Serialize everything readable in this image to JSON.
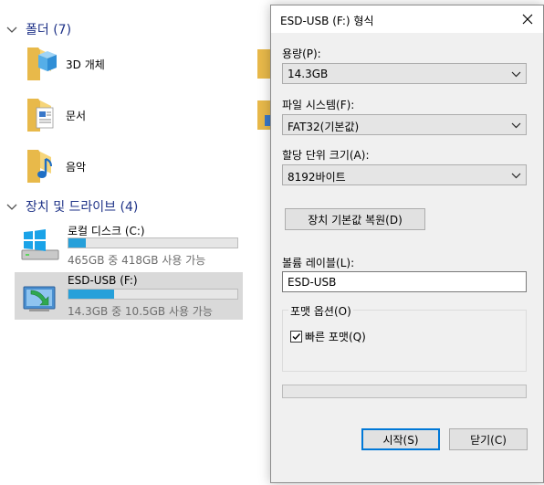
{
  "explorer": {
    "folders_header": "폴더 (7)",
    "folders": [
      {
        "label": "3D 개체",
        "icon": "3d-objects-folder-icon"
      },
      {
        "label": "문서",
        "icon": "documents-folder-icon"
      },
      {
        "label": "음악",
        "icon": "music-folder-icon"
      }
    ],
    "drives_header": "장치 및 드라이브 (4)",
    "drives": [
      {
        "name": "로컬 디스크 (C:)",
        "free_text": "465GB 중 418GB 사용 가능",
        "used_fraction": 0.1,
        "icon": "windows-drive-icon",
        "selected": false
      },
      {
        "name": "ESD-USB (F:)",
        "free_text": "14.3GB 중 10.5GB 사용 가능",
        "used_fraction": 0.27,
        "icon": "usb-drive-icon",
        "selected": true
      }
    ]
  },
  "dialog": {
    "title": "ESD-USB (F:) 형식",
    "capacity_label": "용량(P):",
    "capacity_value": "14.3GB",
    "filesystem_label": "파일 시스템(F):",
    "filesystem_value": "FAT32(기본값)",
    "alloc_label": "할당 단위 크기(A):",
    "alloc_value": "8192바이트",
    "restore_defaults_label": "장치 기본값 복원(D)",
    "volume_label_label": "볼륨 레이블(L):",
    "volume_label_value": "ESD-USB",
    "format_options_label": "포맷 옵션(O)",
    "quick_format_label": "빠른 포맷(Q)",
    "quick_format_checked": true,
    "progress_fraction": 0,
    "start_label": "시작(S)",
    "close_label": "닫기(C)"
  },
  "colors": {
    "header_blue": "#1e3287",
    "drive_bar": "#26a0da",
    "default_button_border": "#0078d7"
  }
}
